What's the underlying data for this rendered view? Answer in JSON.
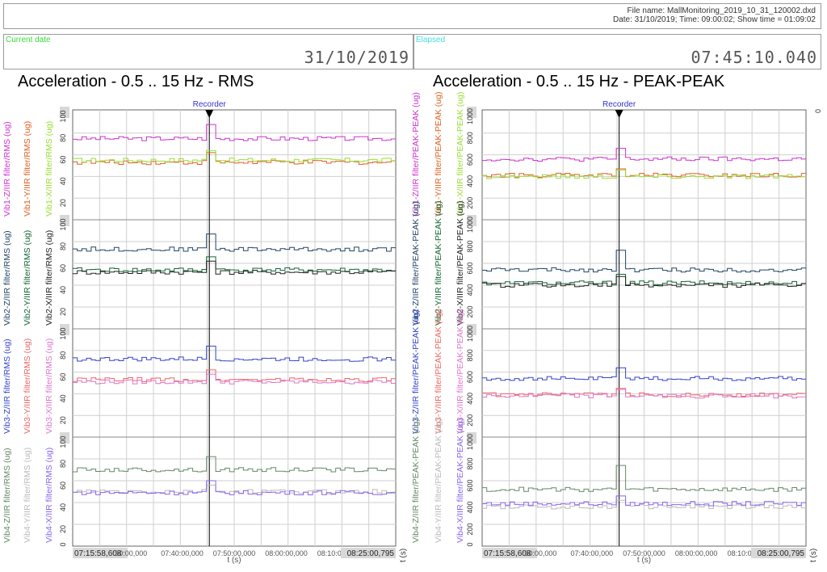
{
  "header": {
    "file_name_line": "File name: MallMonitoring_2019_10_31_120002.dxd",
    "date_line": "Date: 31/10/2019; Time: 09:00:02; Show time = 01:09:02"
  },
  "current_date": {
    "caption": "Current date",
    "value": "31/10/2019"
  },
  "elapsed": {
    "caption": "Elapsed",
    "value": "07:45:10.040"
  },
  "colors": {
    "caption_green": "#33dd33",
    "caption_cyan": "#44dddd",
    "recorder": "#3333cc"
  },
  "panels": [
    {
      "title": "Acceleration - 0.5 .. 15 Hz - RMS",
      "recorder_label": "Recorder",
      "xlabel": "t (s)",
      "x_ticks": [
        "07:15:58,608",
        ":30:00,000",
        "07:40:00,000",
        "07:50:00,000",
        "08:00:00,000",
        "08:10:00,000",
        "08:25:00,795"
      ],
      "y_ticks_top": [
        "100",
        "80",
        "60",
        "40",
        "20"
      ],
      "y_ticks_bottom": [
        "100",
        "80",
        "60",
        "40",
        "20",
        "0"
      ],
      "groups": [
        {
          "channels": [
            {
              "label": "Vib1-Z/IIR filter/RMS (ug)",
              "color": "#cc33cc",
              "level": 75,
              "spike": 88
            },
            {
              "label": "Vib1-Y/IIR filter/RMS (ug)",
              "color": "#e06020",
              "level": 53,
              "spike": 62
            },
            {
              "label": "Vib1-X/IIR filter/RMS (ug)",
              "color": "#99dd33",
              "level": 55,
              "spike": 64
            }
          ]
        },
        {
          "channels": [
            {
              "label": "Vib2-Z/IIR filter/RMS (ug)",
              "color": "#224466",
              "level": 73,
              "spike": 87
            },
            {
              "label": "Vib2-Y/IIR filter/RMS (ug)",
              "color": "#116633",
              "level": 54,
              "spike": 66
            },
            {
              "label": "Vib2-X/IIR filter/RMS (ug)",
              "color": "#222222",
              "level": 52,
              "spike": 62
            }
          ]
        },
        {
          "channels": [
            {
              "label": "Vib3-Z/IIR filter/RMS (ug)",
              "color": "#3344cc",
              "level": 72,
              "spike": 84
            },
            {
              "label": "Vib3-Y/IIR filter/RMS (ug)",
              "color": "#ee6666",
              "level": 53,
              "spike": 62
            },
            {
              "label": "Vib3-X/IIR filter/RMS (ug)",
              "color": "#dd77cc",
              "level": 51,
              "spike": 58
            }
          ]
        },
        {
          "channels": [
            {
              "label": "Vib4-Z/IIR filter/RMS (ug)",
              "color": "#668866",
              "level": 70,
              "spike": 82
            },
            {
              "label": "Vib4-Y/IIR filter/RMS (ug)",
              "color": "#bbbbbb",
              "level": 50,
              "spike": 56
            },
            {
              "label": "Vib4-X/IIR filter/RMS (ug)",
              "color": "#8866ee",
              "level": 49,
              "spike": 60
            }
          ]
        }
      ]
    },
    {
      "title": "Acceleration - 0.5 .. 15 Hz - PEAK-PEAK",
      "recorder_label": "Recorder",
      "xlabel": "t (s)",
      "x_ticks": [
        "07:15:58,608",
        ":30:00,000",
        "07:40:00,000",
        "07:50:00,000",
        "08:00:00,000",
        "08:10:00,000",
        "08:25:00,795"
      ],
      "y_ticks_top": [
        "1000",
        "800",
        "600",
        "400",
        "200"
      ],
      "y_ticks_bottom": [
        "1000",
        "800",
        "600",
        "400",
        "200",
        "0"
      ],
      "right_axis_tick": "0",
      "groups": [
        {
          "channels": [
            {
              "label": "Vib1-Z/IIR filter/PEAK-PEAK (ug)",
              "color": "#cc33cc",
              "level": 560,
              "spike": 660
            },
            {
              "label": "Vib1-Y/IIR filter/PEAK-PEAK (ug)",
              "color": "#e06020",
              "level": 410,
              "spike": 470
            },
            {
              "label": "Vib1-X/IIR filter/PEAK-PEAK (ug)",
              "color": "#99dd33",
              "level": 400,
              "spike": 460
            }
          ]
        },
        {
          "channels": [
            {
              "label": "Vib2-Z/IIR filter/PEAK-PEAK (ug)",
              "color": "#224466",
              "level": 540,
              "spike": 720
            },
            {
              "label": "Vib2-Y/IIR filter/PEAK-PEAK (ug)",
              "color": "#116633",
              "level": 420,
              "spike": 500
            },
            {
              "label": "Vib2-X/IIR filter/PEAK-PEAK (ug)",
              "color": "#222222",
              "level": 400,
              "spike": 480
            }
          ]
        },
        {
          "channels": [
            {
              "label": "Vib3-Z/IIR filter/PEAK-PEAK (ug)",
              "color": "#3344cc",
              "level": 540,
              "spike": 640
            },
            {
              "label": "Vib3-Y/IIR filter/PEAK-PEAK (ug)",
              "color": "#ee6666",
              "level": 390,
              "spike": 450
            },
            {
              "label": "Vib3-X/IIR filter/PEAK-PEAK (ug)",
              "color": "#dd77cc",
              "level": 380,
              "spike": 440
            }
          ]
        },
        {
          "channels": [
            {
              "label": "Vib4-Z/IIR filter/PEAK-PEAK (ug)",
              "color": "#668866",
              "level": 520,
              "spike": 740
            },
            {
              "label": "Vib4-Y/IIR filter/PEAK-PEAK (ug)",
              "color": "#bbbbbb",
              "level": 360,
              "spike": 420
            },
            {
              "label": "Vib4-X/IIR filter/PEAK-PEAK (ug)",
              "color": "#8866ee",
              "level": 390,
              "spike": 460
            }
          ]
        }
      ]
    }
  ]
}
